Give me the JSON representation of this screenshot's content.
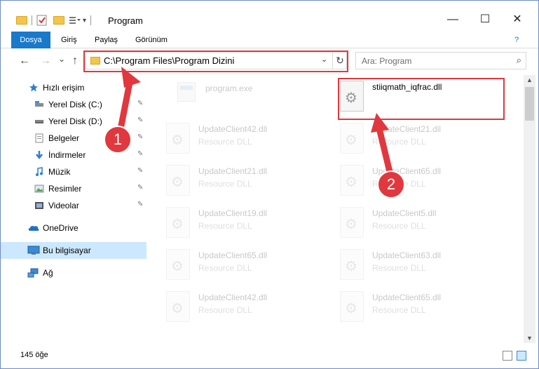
{
  "window": {
    "title": "Program",
    "minimize": "—",
    "maximize": "☐",
    "close": "✕"
  },
  "ribbon": {
    "tabs": [
      {
        "label": "Dosya",
        "active": true
      },
      {
        "label": "Giriş"
      },
      {
        "label": "Paylaş"
      },
      {
        "label": "Görünüm"
      }
    ],
    "help": "?"
  },
  "navigation": {
    "back": "←",
    "forward": "→",
    "recent": "⌄",
    "up": "↑",
    "address": "C:\\Program Files\\Program Dizini",
    "address_dropdown": "⌄",
    "refresh": "↻",
    "search_placeholder": "Ara: Program",
    "search_icon": "⌕"
  },
  "sidebar": {
    "items": [
      {
        "label": "Hızlı erişim",
        "icon": "star-icon",
        "pinned": false
      },
      {
        "label": "Yerel Disk (C:)",
        "icon": "drive-icon",
        "pinned": true
      },
      {
        "label": "Yerel Disk (D:)",
        "icon": "drive-icon",
        "pinned": true
      },
      {
        "label": "Belgeler",
        "icon": "documents-icon",
        "pinned": true
      },
      {
        "label": "İndirmeler",
        "icon": "download-icon",
        "pinned": true
      },
      {
        "label": "Müzik",
        "icon": "music-icon",
        "pinned": true
      },
      {
        "label": "Resimler",
        "icon": "pictures-icon",
        "pinned": true
      },
      {
        "label": "Videolar",
        "icon": "videos-icon",
        "pinned": true
      },
      {
        "label": "OneDrive",
        "icon": "cloud-icon",
        "pinned": false
      },
      {
        "label": "Bu bilgisayar",
        "icon": "computer-icon",
        "pinned": false,
        "selected": true
      },
      {
        "label": "Ağ",
        "icon": "network-icon",
        "pinned": false
      }
    ],
    "pin_glyph": "📌"
  },
  "files": [
    {
      "name": "program.exe",
      "type": "",
      "faded": true
    },
    {
      "name": "stiiqmath_iqfrac.dll",
      "type": "",
      "faded": false
    },
    {
      "name": "UpdateClient42.dll",
      "type": "Resource DLL",
      "faded": true
    },
    {
      "name": "UpdateClient21.dll",
      "type": "Resource DLL",
      "faded": true
    },
    {
      "name": "UpdateClient21.dll",
      "type": "Resource DLL",
      "faded": true
    },
    {
      "name": "UpdateClient65.dll",
      "type": "Resource DLL",
      "faded": true
    },
    {
      "name": "UpdateClient19.dll",
      "type": "Resource DLL",
      "faded": true
    },
    {
      "name": "UpdateClient5.dll",
      "type": "Resource DLL",
      "faded": true
    },
    {
      "name": "UpdateClient65.dll",
      "type": "Resource DLL",
      "faded": true
    },
    {
      "name": "UpdateClient63.dll",
      "type": "Resource DLL",
      "faded": true
    },
    {
      "name": "UpdateClient42.dll",
      "type": "Resource DLL",
      "faded": true
    },
    {
      "name": "UpdateClient65.dll",
      "type": "Resource DLL",
      "faded": true
    }
  ],
  "status": {
    "count": "145 öğe"
  },
  "annotations": {
    "badge1": "1",
    "badge2": "2",
    "color": "#e0383e"
  }
}
